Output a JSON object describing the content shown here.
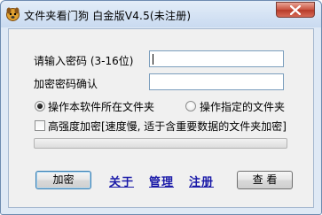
{
  "window": {
    "title": "文件夹看门狗 白金版V4.5(未注册)",
    "icon": "dog-icon",
    "close_icon": "close-icon"
  },
  "form": {
    "password_label": "请输入密码 (3-16位)",
    "password_value": "",
    "confirm_label": "加密密码确认",
    "confirm_value": ""
  },
  "options": {
    "radio_own_folder": "操作本软件所在文件夹",
    "radio_own_folder_selected": true,
    "radio_specified_folder": "操作指定的文件夹",
    "radio_specified_folder_selected": false,
    "strong_encrypt_label": "高强度加密[速度慢, 适于含重要数据的文件夹加密]",
    "strong_encrypt_checked": false
  },
  "progress": {
    "value": 0
  },
  "actions": {
    "encrypt_button": "加密",
    "about_link": "关于",
    "manage_link": "管理",
    "register_link": "注册",
    "view_button": "查 看"
  },
  "colors": {
    "link": "#1a1aa8",
    "close_button": "#c9523f",
    "frame": "#dfe9f5"
  }
}
